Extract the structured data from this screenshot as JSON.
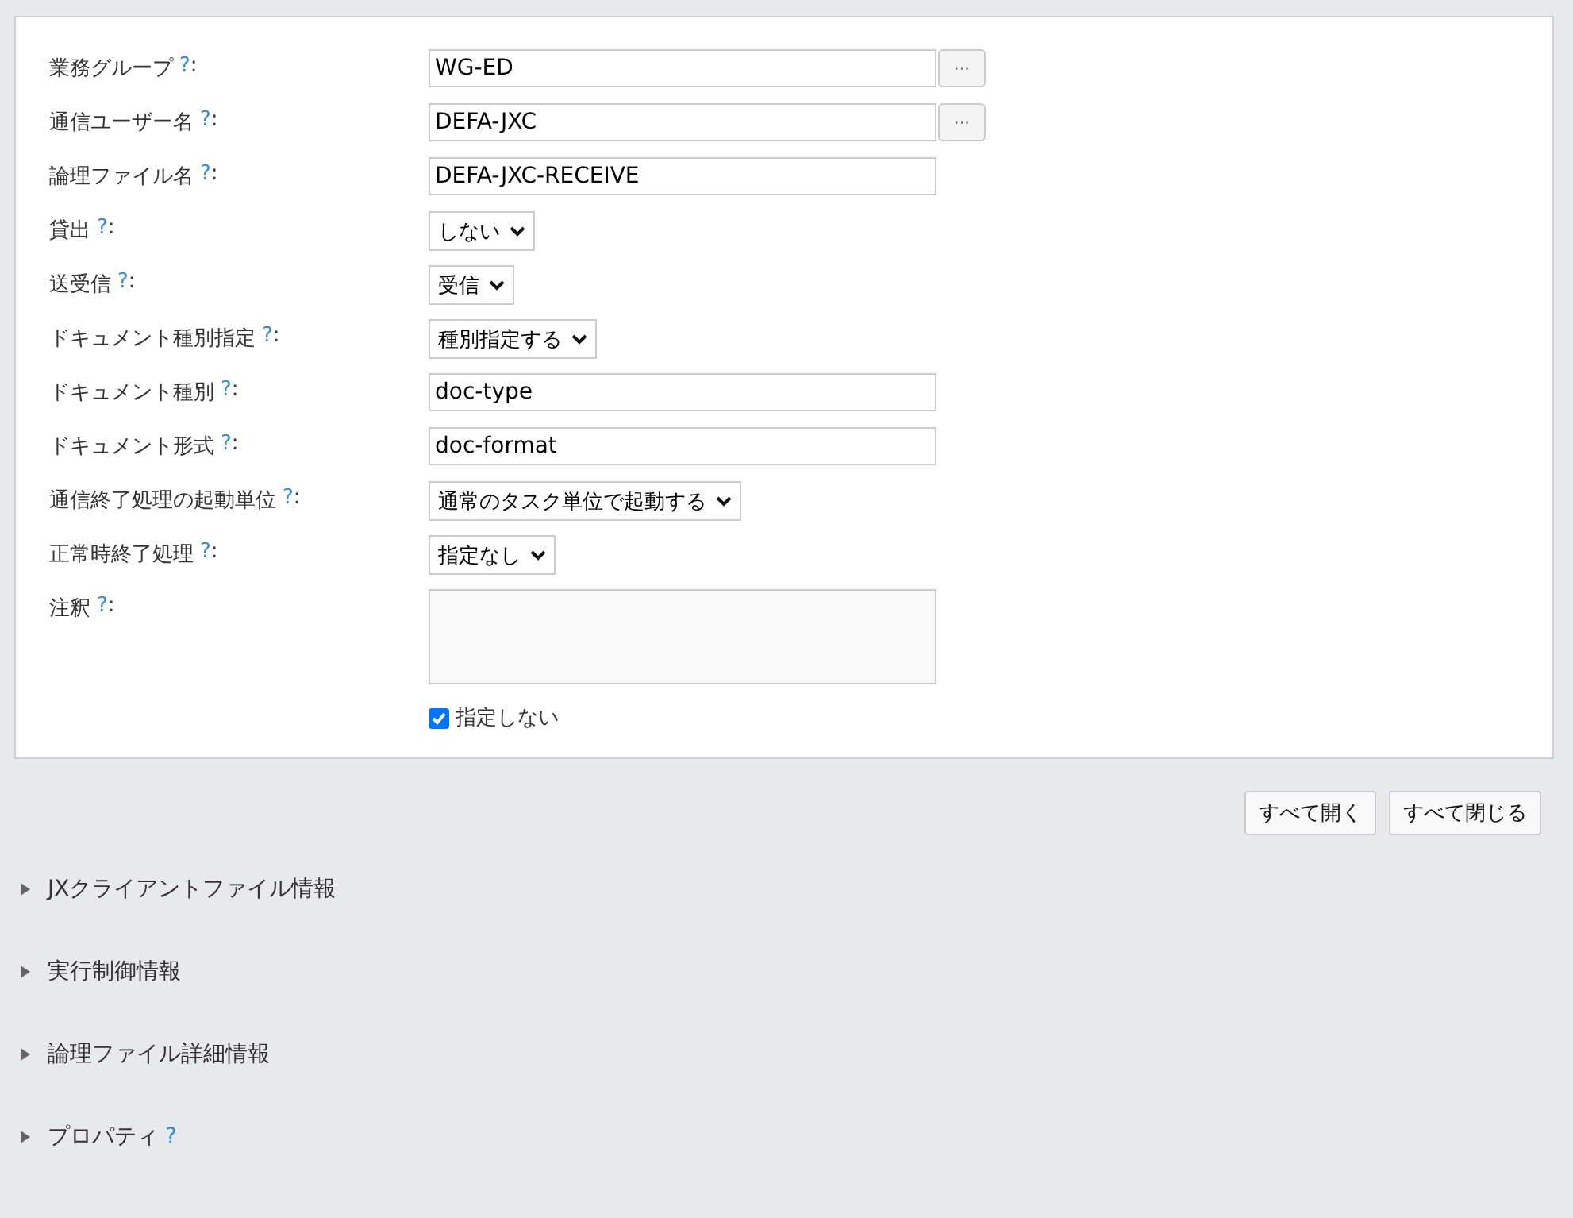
{
  "form": {
    "rows": [
      {
        "kind": "text",
        "label": "業務グループ",
        "help": "?",
        "suffix": ":",
        "value": "WG-ED",
        "browse": "···"
      },
      {
        "kind": "text",
        "label": "通信ユーザー名",
        "help": "?",
        "suffix": ":",
        "value": "DEFA-JXC",
        "browse": "···"
      },
      {
        "kind": "text",
        "label": "論理ファイル名",
        "help": "?",
        "suffix": ":",
        "value": "DEFA-JXC-RECEIVE"
      },
      {
        "kind": "select",
        "label": "貸出",
        "help": "?",
        "suffix": ":",
        "value": "しない"
      },
      {
        "kind": "select",
        "label": "送受信",
        "help": "?",
        "suffix": ":",
        "value": "受信"
      },
      {
        "kind": "select",
        "label": "ドキュメント種別指定",
        "help": "?",
        "suffix": ":",
        "value": "種別指定する"
      },
      {
        "kind": "text",
        "label": "ドキュメント種別",
        "help": "?",
        "suffix": ":",
        "value": "doc-type"
      },
      {
        "kind": "text",
        "label": "ドキュメント形式",
        "help": "?",
        "suffix": ":",
        "value": "doc-format"
      },
      {
        "kind": "select",
        "label": "通信終了処理の起動単位",
        "help": "?",
        "suffix": ":",
        "value": "通常のタスク単位で起動する"
      },
      {
        "kind": "select",
        "label": "正常時終了処理",
        "help": "?",
        "suffix": ":",
        "value": "指定なし"
      },
      {
        "kind": "textarea",
        "label": "注釈",
        "help": "?",
        "suffix": ":",
        "checkbox": {
          "label": "指定しない",
          "checked": true
        }
      }
    ]
  },
  "buttons": [
    "すべて開く",
    "すべて閉じる"
  ],
  "sections": [
    {
      "title": "JXクライアントファイル情報",
      "expanded": false
    },
    {
      "title": "実行制御情報",
      "expanded": false
    },
    {
      "title": "論理ファイル詳細情報",
      "expanded": false
    },
    {
      "title": "プロパティ",
      "help": "?",
      "expanded": false
    }
  ]
}
